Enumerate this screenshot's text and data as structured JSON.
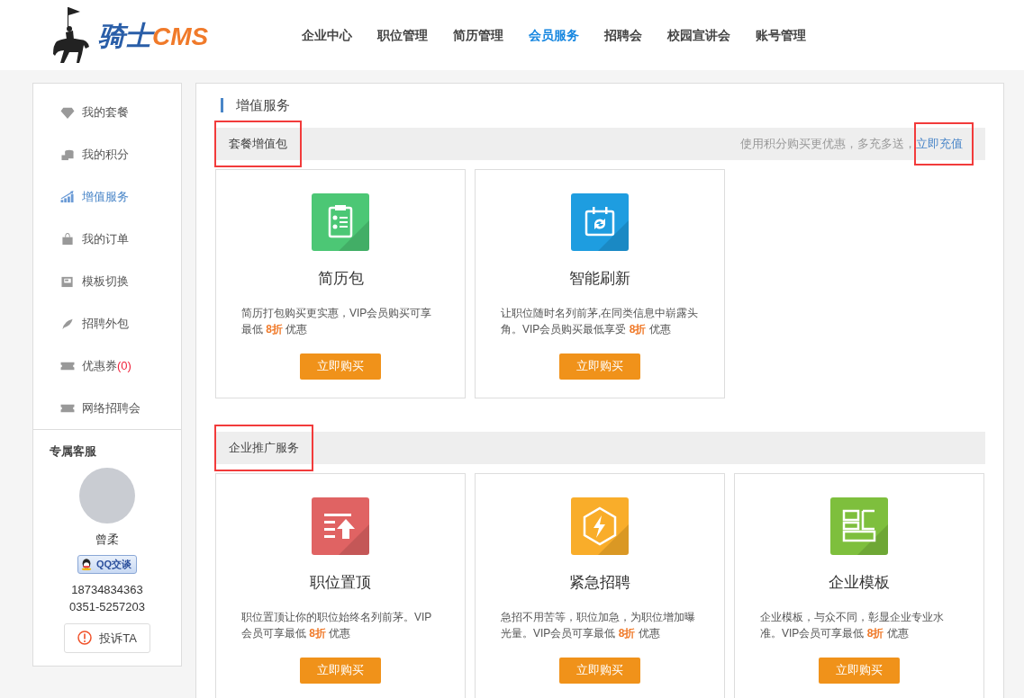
{
  "logo": {
    "text_cn": "骑士",
    "text_en": "CMS"
  },
  "nav": [
    {
      "label": "企业中心",
      "selected": false
    },
    {
      "label": "职位管理",
      "selected": false
    },
    {
      "label": "简历管理",
      "selected": false
    },
    {
      "label": "会员服务",
      "selected": true
    },
    {
      "label": "招聘会",
      "selected": false
    },
    {
      "label": "校园宣讲会",
      "selected": false
    },
    {
      "label": "账号管理",
      "selected": false
    }
  ],
  "sidebar": {
    "items": [
      {
        "label": "我的套餐",
        "kind": "diamond",
        "selected": false
      },
      {
        "label": "我的积分",
        "kind": "coins",
        "selected": false
      },
      {
        "label": "增值服务",
        "kind": "chart",
        "selected": true
      },
      {
        "label": "我的订单",
        "kind": "bag",
        "selected": false
      },
      {
        "label": "模板切换",
        "kind": "template",
        "selected": false
      },
      {
        "label": "招聘外包",
        "kind": "feather",
        "selected": false
      },
      {
        "label": "优惠券",
        "count": "(0)",
        "kind": "ticket",
        "selected": false
      },
      {
        "label": "网络招聘会",
        "kind": "ticket",
        "selected": false
      }
    ],
    "service": {
      "title": "专属客服",
      "name": "曾柔",
      "qq_label": "QQ交谈",
      "phones": [
        "18734834363",
        "0351-5257203"
      ],
      "complain": "投诉TA"
    }
  },
  "page_title": "增值服务",
  "sections": [
    {
      "title": "套餐增值包",
      "highlighted": true,
      "note": "使用积分购买更优惠，多充多送，",
      "link": "立即充值",
      "link_highlighted": true,
      "cards": [
        {
          "kind": "clipboard",
          "title": "简历包",
          "desc": "简历打包购买更实惠，VIP会员购买可享最低 **8折** 优惠",
          "button": "立即购买"
        },
        {
          "kind": "calendar",
          "title": "智能刷新",
          "desc": "让职位随时名列前茅,在同类信息中崭露头角。VIP会员购买最低享受 **8折** 优惠",
          "button": "立即购买"
        }
      ]
    },
    {
      "title": "企业推广服务",
      "highlighted": true,
      "cards": [
        {
          "kind": "top",
          "title": "职位置顶",
          "desc": "职位置顶让你的职位始终名列前茅。VIP会员可享最低 **8折** 优惠",
          "button": "立即购买"
        },
        {
          "kind": "bolt",
          "title": "紧急招聘",
          "desc": "急招不用苦等，职位加急，为职位增加曝光量。VIP会员可享最低 **8折** 优惠",
          "button": "立即购买"
        },
        {
          "kind": "layout",
          "title": "企业模板",
          "desc": "企业模板，与众不同，彰显企业专业水准。VIP会员可享最低 **8折** 优惠",
          "button": "立即购买"
        }
      ]
    }
  ]
}
